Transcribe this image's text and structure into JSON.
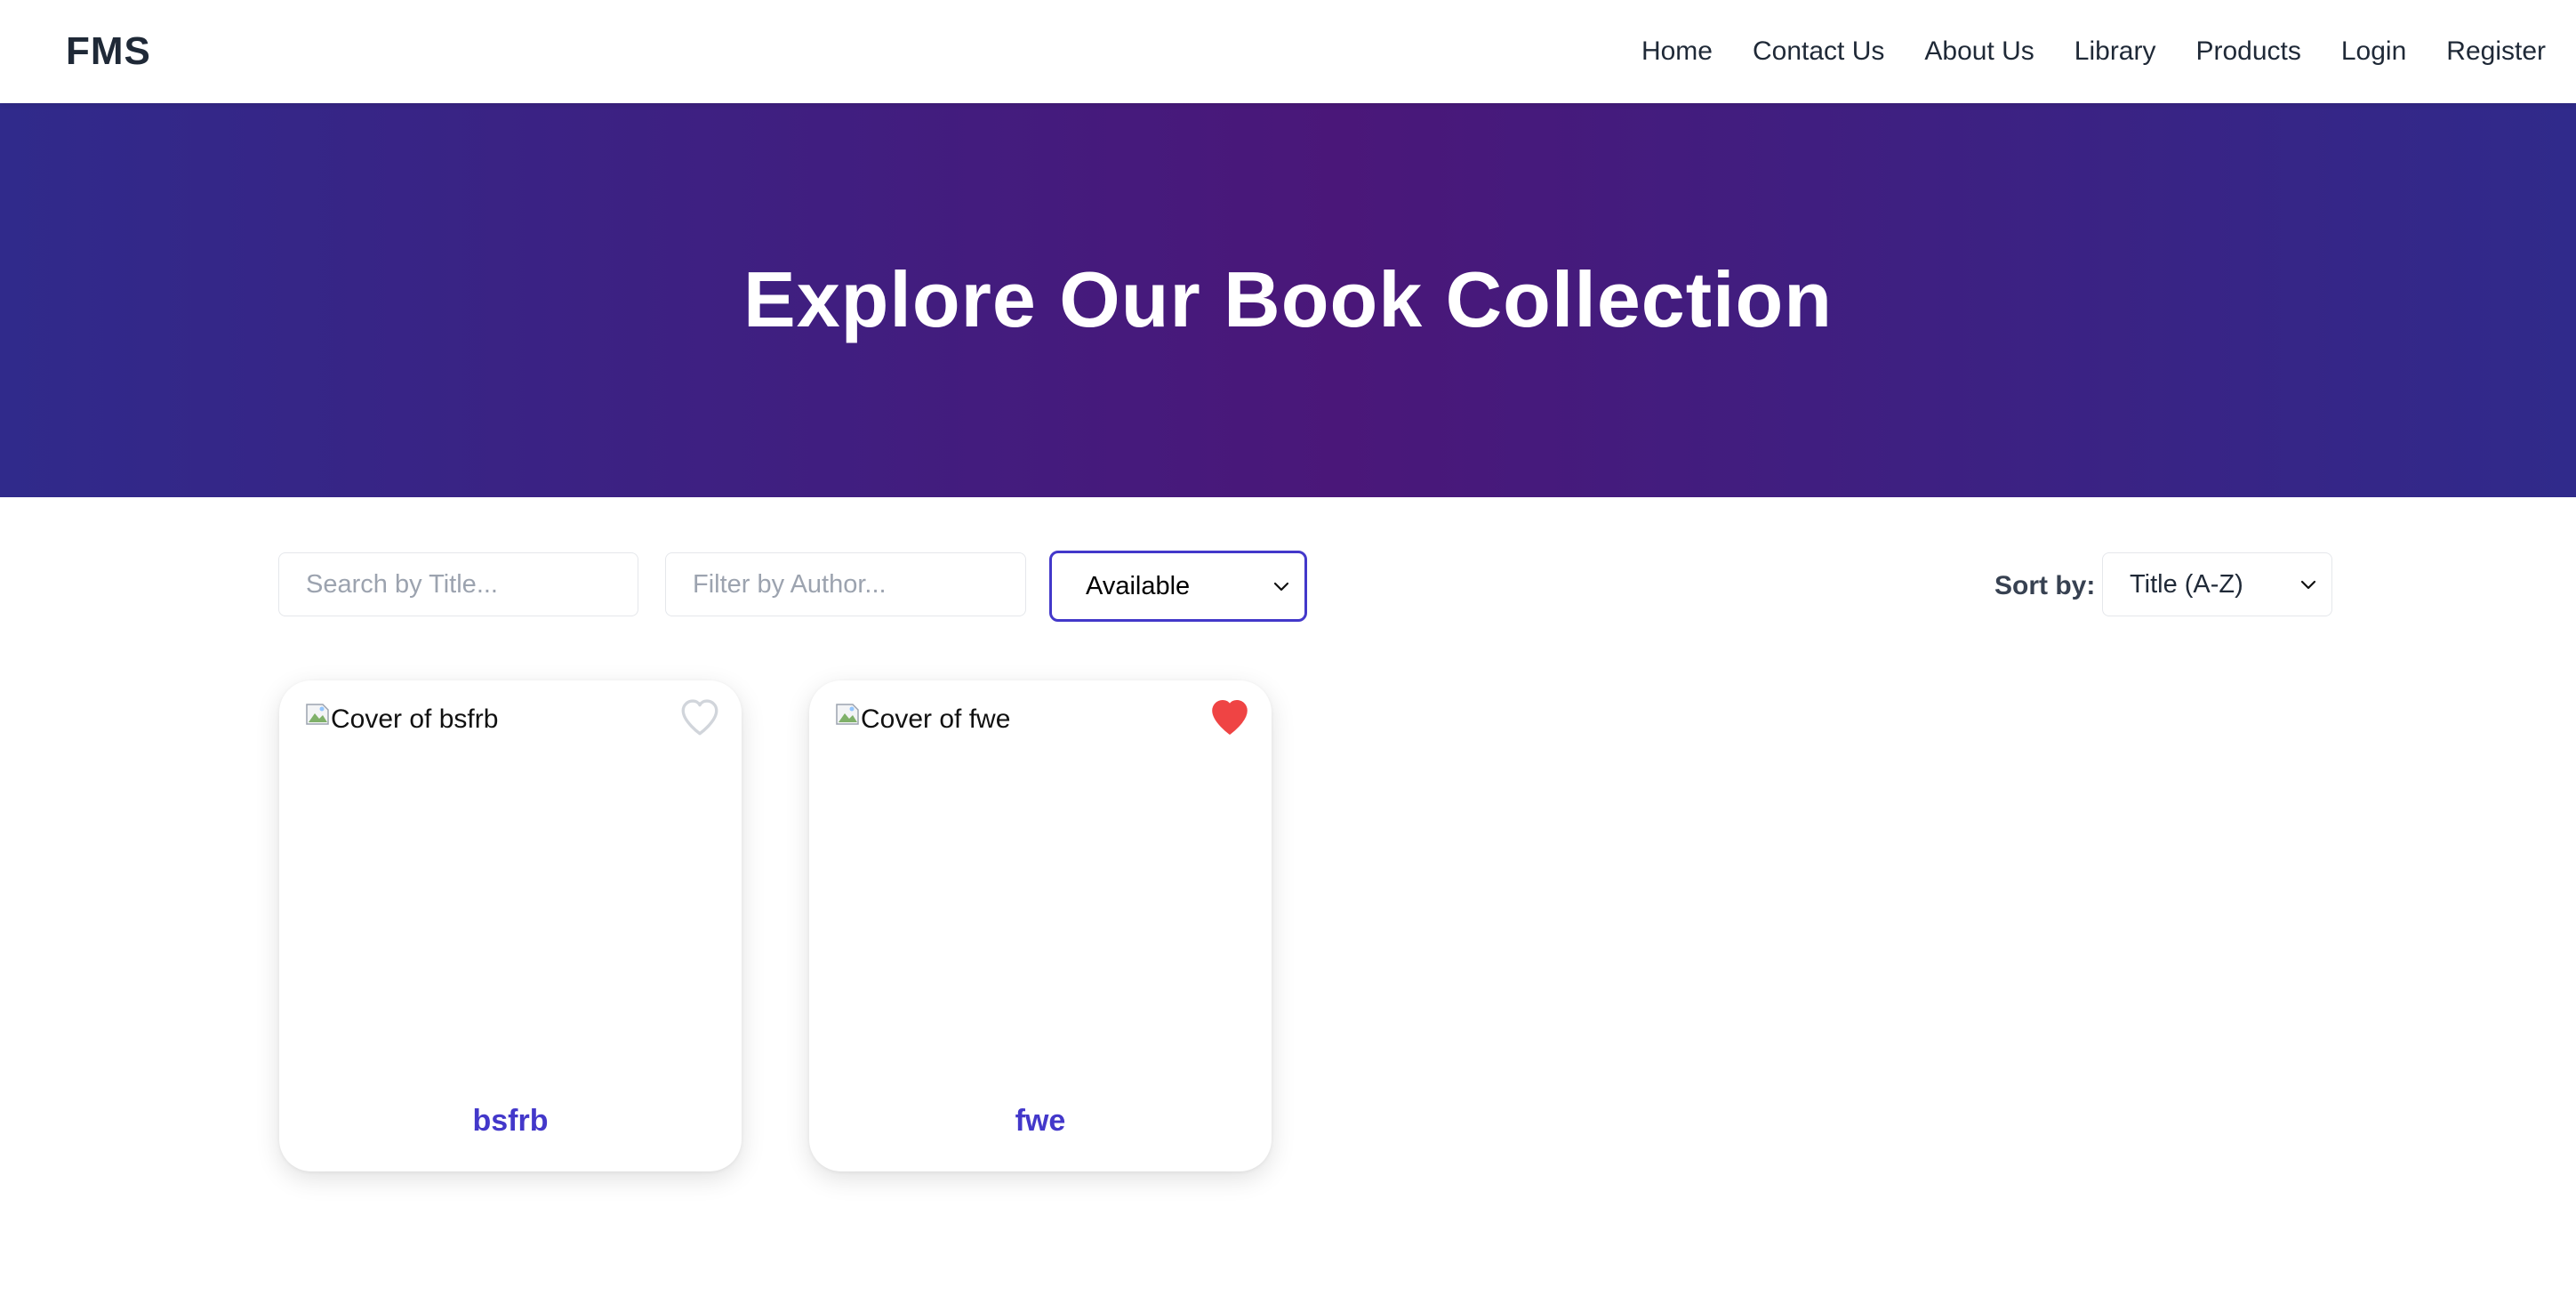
{
  "navbar": {
    "brand": "FMS",
    "links": [
      "Home",
      "Contact Us",
      "About Us",
      "Library",
      "Products",
      "Login",
      "Register"
    ]
  },
  "hero": {
    "title": "Explore Our Book Collection"
  },
  "filters": {
    "title_placeholder": "Search by Title...",
    "author_placeholder": "Filter by Author...",
    "status_selected": "Available",
    "sort_label": "Sort by:",
    "sort_selected": "Title (A-Z)"
  },
  "books": [
    {
      "title": "bsfrb",
      "cover_alt": "Cover of bsfrb",
      "favorite": false,
      "heart_icon": "heart-outline-icon"
    },
    {
      "title": "fwe",
      "cover_alt": "Cover of fwe",
      "favorite": true,
      "heart_icon": "heart-filled-icon"
    }
  ],
  "colors": {
    "hero_gradient": [
      "#302a8b",
      "#4a1779"
    ],
    "accent": "#4338ca",
    "favorite": "#ef4444",
    "heart_outline": "#d1d5db"
  }
}
